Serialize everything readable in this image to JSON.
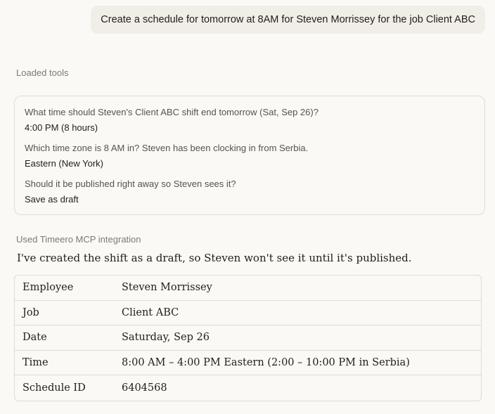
{
  "user_message": "Create a schedule for tomorrow at 8AM  for Steven Morrissey for the job Client ABC",
  "loaded_tools_label": "Loaded tools",
  "questions": [
    {
      "question": "What time should Steven's Client ABC shift end tomorrow (Sat, Sep 26)?",
      "answer": "4:00 PM (8 hours)"
    },
    {
      "question": "Which time zone is 8 AM in? Steven has been clocking in from Serbia.",
      "answer": "Eastern (New York)"
    },
    {
      "question": "Should it be published right away so Steven sees it?",
      "answer": "Save as draft"
    }
  ],
  "integration_label": "Used Timeero MCP integration",
  "response_text": "I've created the shift as a draft, so Steven won't see it until it's published.",
  "table": {
    "rows": [
      {
        "label": "Employee",
        "value": "Steven Morrissey"
      },
      {
        "label": "Job",
        "value": "Client ABC"
      },
      {
        "label": "Date",
        "value": "Saturday, Sep 26"
      },
      {
        "label": "Time",
        "value": "8:00 AM – 4:00 PM Eastern (2:00 – 10:00 PM in Serbia)"
      },
      {
        "label": "Schedule ID",
        "value": "6404568"
      }
    ]
  }
}
